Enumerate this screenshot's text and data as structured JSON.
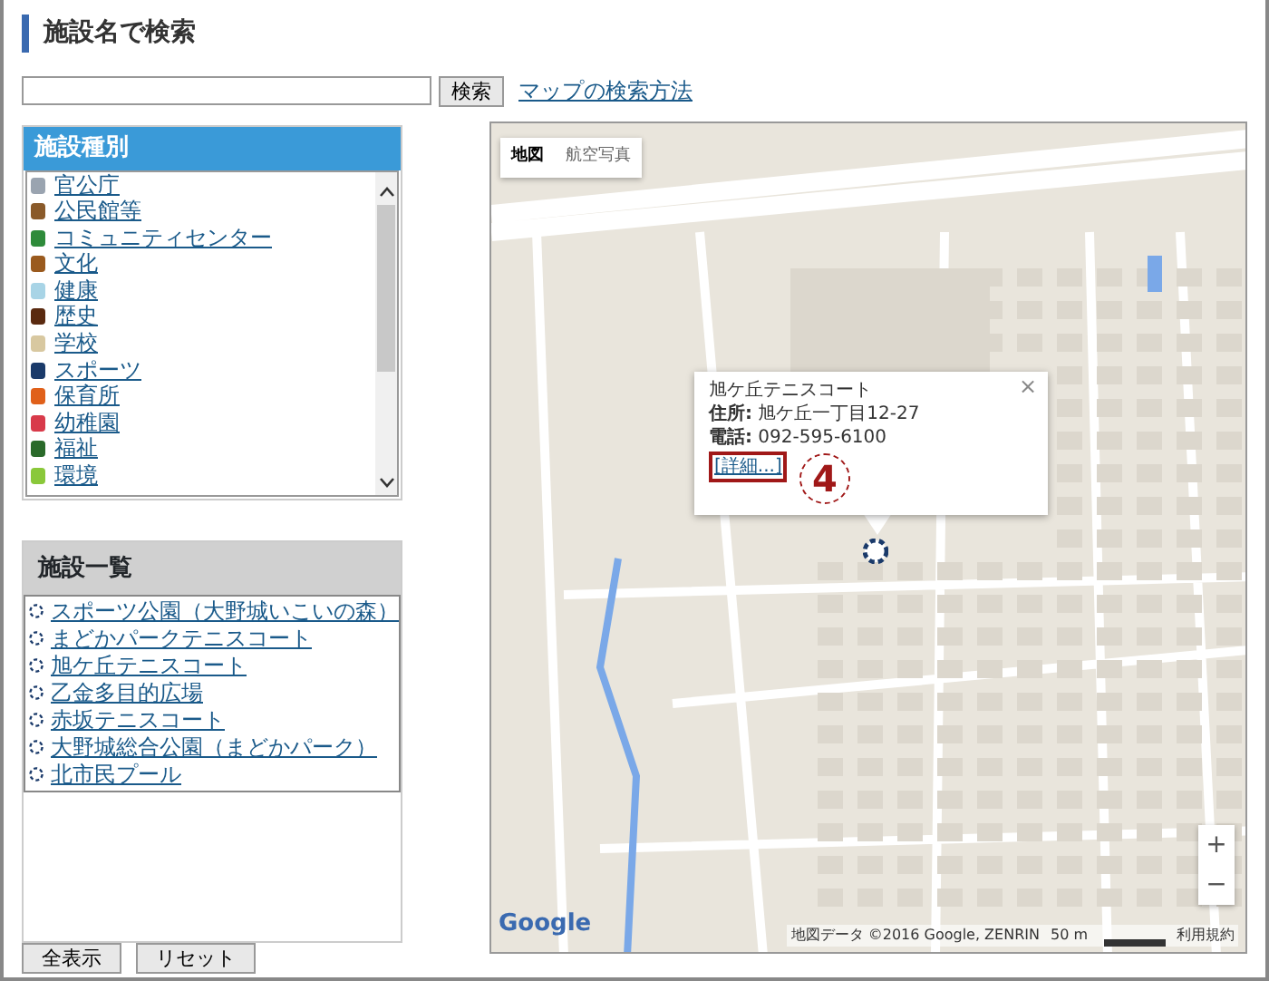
{
  "page_title": "施設名で検索",
  "search": {
    "button": "検索",
    "help_link": "マップの検索方法"
  },
  "category_panel": {
    "title": "施設種別",
    "items": [
      {
        "label": "官公庁",
        "color": "#9aa4b0"
      },
      {
        "label": "公民館等",
        "color": "#8a5a2a"
      },
      {
        "label": "コミュニティセンター",
        "color": "#2e8b3a"
      },
      {
        "label": "文化",
        "color": "#9a5a1e"
      },
      {
        "label": "健康",
        "color": "#a8d4e6"
      },
      {
        "label": "歴史",
        "color": "#5a2a10"
      },
      {
        "label": "学校",
        "color": "#d8c8a0"
      },
      {
        "label": "スポーツ",
        "color": "#1a3a6a"
      },
      {
        "label": "保育所",
        "color": "#e0601a"
      },
      {
        "label": "幼稚園",
        "color": "#d83a4a"
      },
      {
        "label": "福祉",
        "color": "#2a6a2a"
      },
      {
        "label": "環境",
        "color": "#8ac83a"
      }
    ]
  },
  "facility_panel": {
    "title": "施設一覧",
    "items": [
      "スポーツ公園（大野城いこいの森）",
      "まどかパークテニスコート",
      "旭ケ丘テニスコート",
      "乙金多目的広場",
      "赤坂テニスコート",
      "大野城総合公園（まどかパーク）",
      "北市民プール"
    ]
  },
  "buttons": [
    "全表示",
    "リセット"
  ],
  "map": {
    "tabs": [
      {
        "label": "地図",
        "selected": true
      },
      {
        "label": "航空写真",
        "selected": false
      }
    ],
    "info_window": {
      "title": "旭ケ丘テニスコート",
      "address": "**住所:** 旭ケ丘一丁目12-27",
      "phone": "**電話:** 092-595-6100",
      "detail_link": "[詳細...]",
      "close": "×"
    },
    "annotation": "4",
    "zoom_in": "+",
    "zoom_out": "−",
    "logo": "Google",
    "attribution": "地図データ ©2016 Google, ZENRIN",
    "scale": "50 m",
    "terms": "利用規約"
  }
}
